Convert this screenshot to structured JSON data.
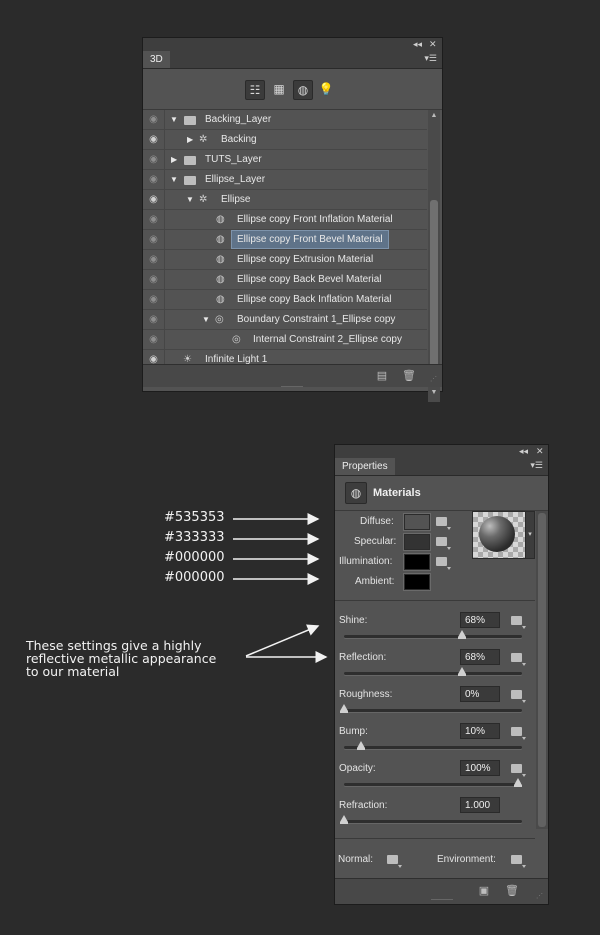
{
  "panel3d": {
    "tab": "3D",
    "window_controls": {
      "collapse": "◂◂",
      "close": "✕"
    },
    "filter_tools": [
      "whole-scene-icon",
      "meshes-icon",
      "materials-icon",
      "lights-icon"
    ],
    "layers": [
      {
        "label": "Backing_Layer",
        "icon": "folder-3d-icon",
        "expand": "▼",
        "eye": false
      },
      {
        "label": "Backing",
        "icon": "mesh-icon",
        "expand": "▶",
        "eye": true
      },
      {
        "label": "TUTS_Layer",
        "icon": "folder-3d-icon",
        "expand": "▶",
        "eye": false
      },
      {
        "label": "Ellipse_Layer",
        "icon": "folder-3d-icon",
        "expand": "▼",
        "eye": false
      },
      {
        "label": "Ellipse",
        "icon": "mesh-icon",
        "expand": "▼",
        "eye": true
      },
      {
        "label": "Ellipse copy Front Inflation Material",
        "icon": "material-icon",
        "eye": false
      },
      {
        "label": "Ellipse copy Front Bevel Material",
        "icon": "material-icon",
        "eye": false,
        "selected": true
      },
      {
        "label": "Ellipse copy Extrusion Material",
        "icon": "material-icon",
        "eye": false
      },
      {
        "label": "Ellipse copy Back Bevel Material",
        "icon": "material-icon",
        "eye": false
      },
      {
        "label": "Ellipse copy Back Inflation Material",
        "icon": "material-icon",
        "eye": false
      },
      {
        "label": "Boundary Constraint 1_Ellipse copy",
        "icon": "constraint-icon",
        "expand": "▼",
        "eye": false
      },
      {
        "label": "Internal Constraint 2_Ellipse copy",
        "icon": "constraint-icon",
        "eye": false
      },
      {
        "label": "Infinite Light 1",
        "icon": "infinite-light-icon",
        "eye": true
      }
    ]
  },
  "properties": {
    "tab": "Properties",
    "section_title": "Materials",
    "swatches": [
      {
        "label": "Diffuse:",
        "color": "#535353"
      },
      {
        "label": "Specular:",
        "color": "#333333"
      },
      {
        "label": "Illumination:",
        "color": "#000000"
      },
      {
        "label": "Ambient:",
        "color": "#000000"
      }
    ],
    "sliders": [
      {
        "label": "Shine:",
        "value": "68%",
        "level": 0.68
      },
      {
        "label": "Reflection:",
        "value": "68%",
        "level": 0.68
      },
      {
        "label": "Roughness:",
        "value": "0%",
        "level": 0.0
      },
      {
        "label": "Bump:",
        "value": "10%",
        "level": 0.1
      },
      {
        "label": "Opacity:",
        "value": "100%",
        "level": 1.0
      },
      {
        "label": "Refraction:",
        "value": "1.000",
        "level": 0.0
      }
    ],
    "normal_label": "Normal:",
    "environment_label": "Environment:"
  },
  "annotations": {
    "hex_labels": [
      "#535353",
      "#333333",
      "#000000",
      "#000000"
    ],
    "note_lines": [
      "These settings give a highly",
      "reflective metallic appearance",
      "to our material"
    ]
  }
}
